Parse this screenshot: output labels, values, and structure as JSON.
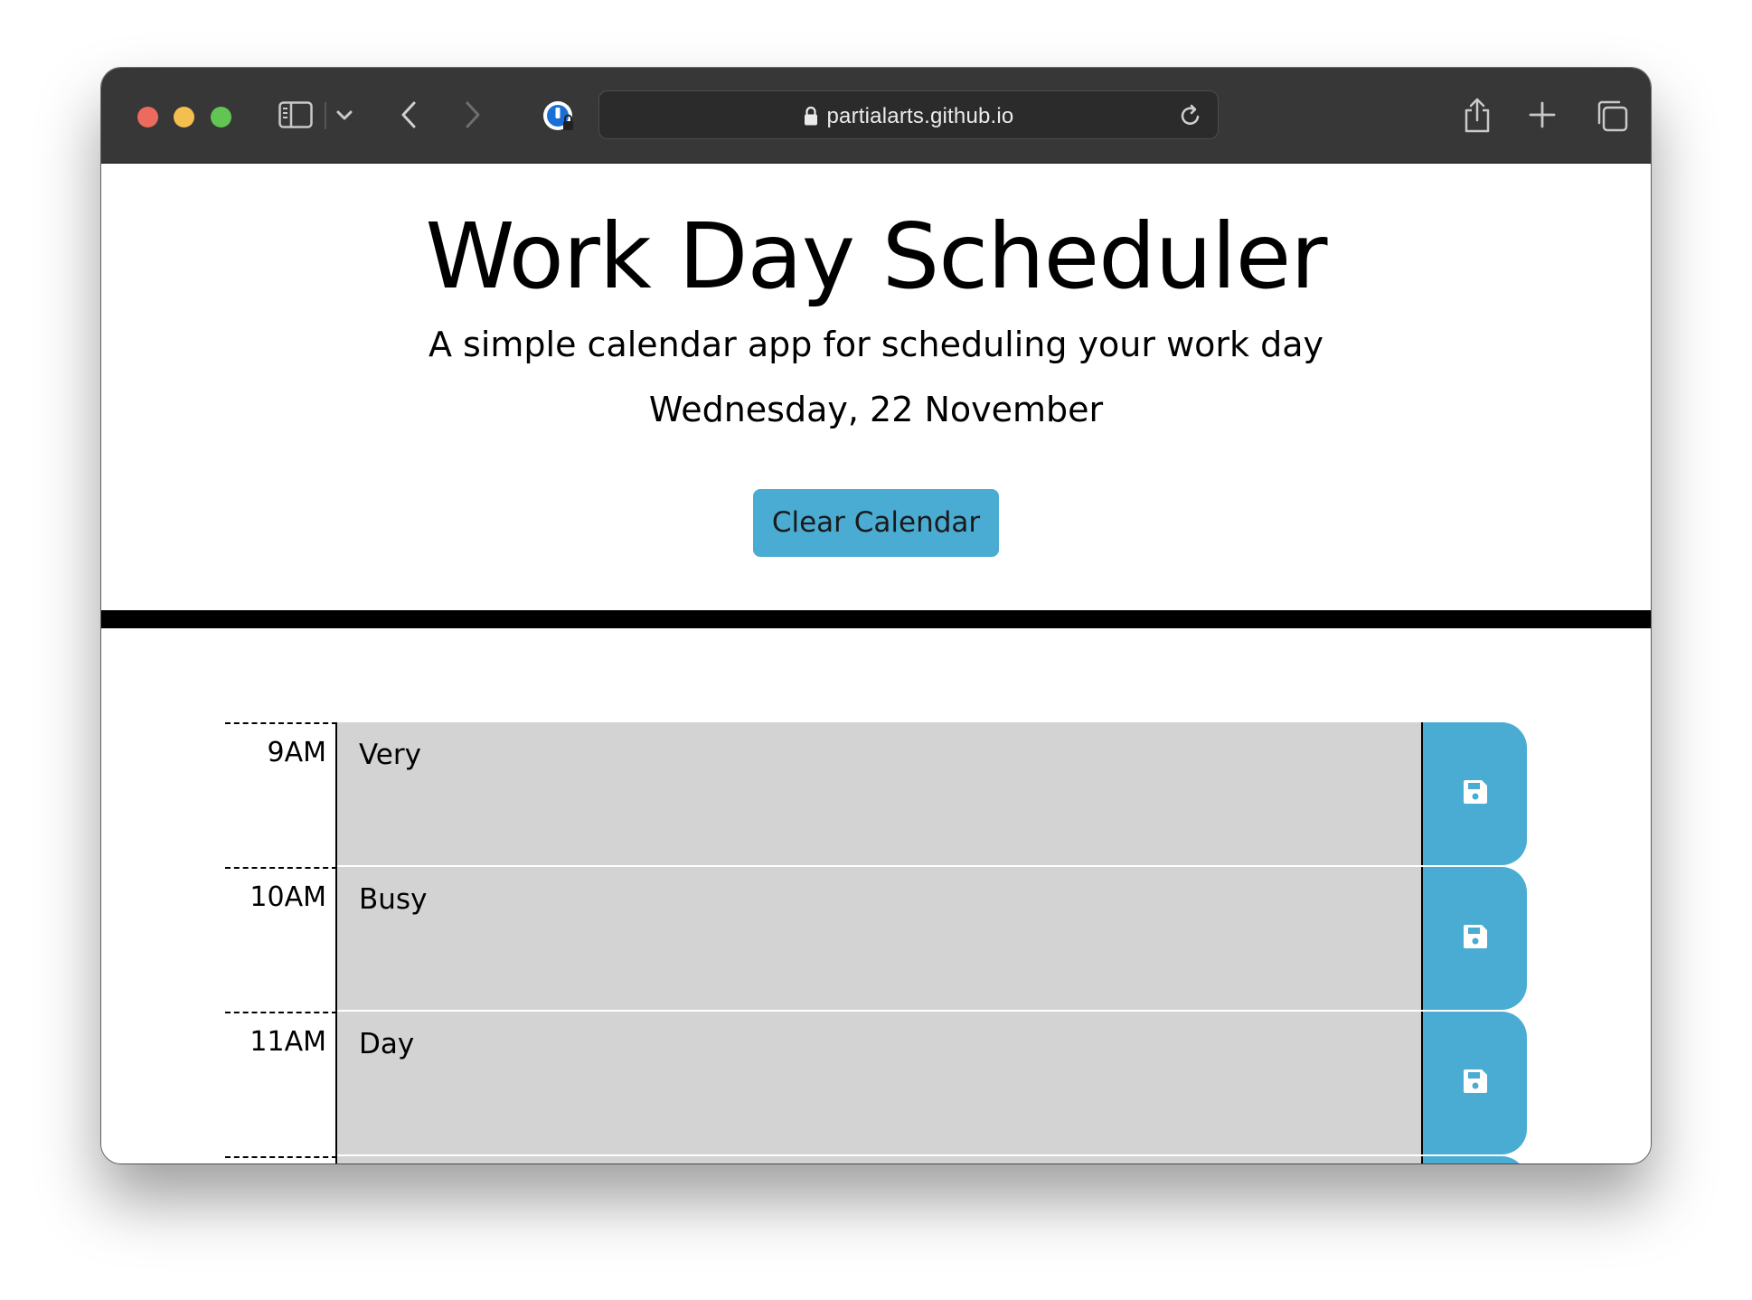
{
  "browser": {
    "url": "partialarts.github.io"
  },
  "header": {
    "title": "Work Day Scheduler",
    "lead": "A simple calendar app for scheduling your work day",
    "current_day": "Wednesday, 22 November",
    "clear_button": "Clear Calendar"
  },
  "colors": {
    "accent": "#4aacd2",
    "past_block": "#d3d3d3",
    "toolbar": "#373737"
  },
  "schedule": {
    "rows": [
      {
        "hour": "9AM",
        "description": "Very"
      },
      {
        "hour": "10AM",
        "description": "Busy"
      },
      {
        "hour": "11AM",
        "description": "Day"
      },
      {
        "hour": "",
        "description": ""
      }
    ],
    "save_icon": "save-icon"
  }
}
